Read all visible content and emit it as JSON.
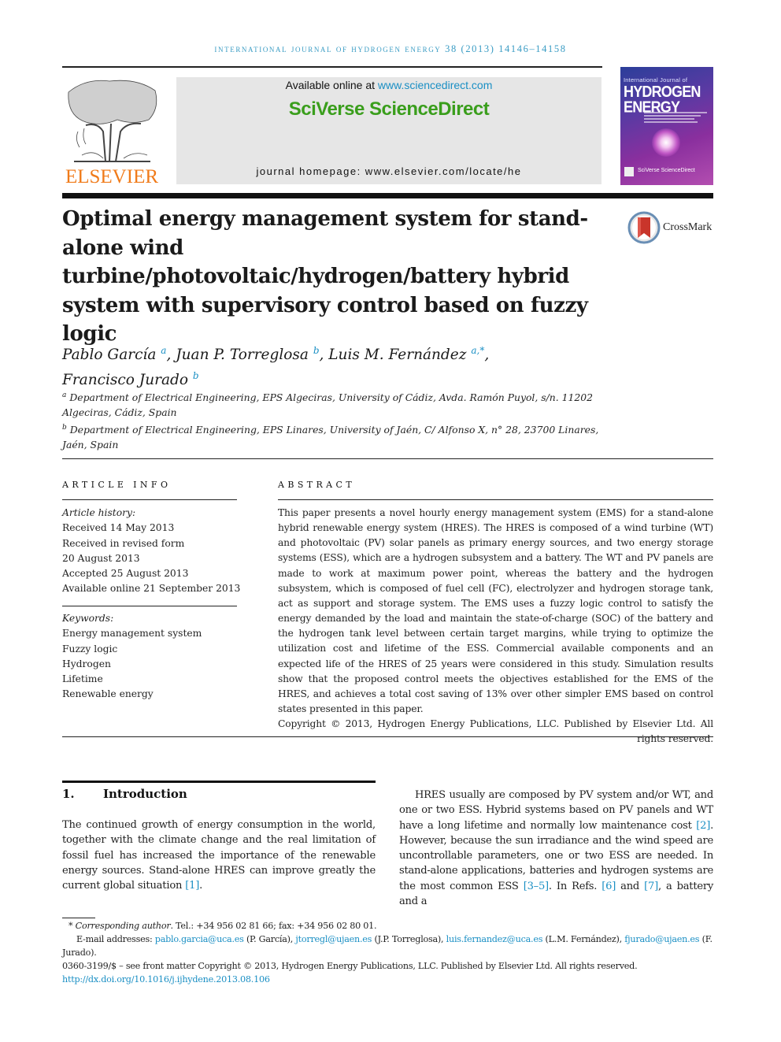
{
  "running_head": "International Journal of Hydrogen Energy 38 (2013) 14146–14158",
  "publisher": {
    "logo_text": "ELSEVIER",
    "logo_color": "#f07b1a"
  },
  "sciencedirect": {
    "available_prefix": "Available online at ",
    "available_link": "www.sciencedirect.com",
    "brand": "SciVerse ScienceDirect",
    "homepage": "journal homepage: www.elsevier.com/locate/he",
    "brand_color": "#3a9e1c",
    "link_color": "#1a8fc4"
  },
  "cover": {
    "small_title": "International Journal of",
    "title_line1": "HYDROGEN",
    "title_line2": "ENERGY",
    "footer": "SciVerse ScienceDirect"
  },
  "crossmark_label": "CrossMark",
  "title": "Optimal energy management system for stand-alone wind turbine/photovoltaic/hydrogen/battery hybrid system with supervisory control based on fuzzy logic",
  "authors": [
    {
      "name": "Pablo García",
      "aff": "a"
    },
    {
      "name": "Juan P. Torreglosa",
      "aff": "b"
    },
    {
      "name": "Luis M. Fernández",
      "aff": "a,*"
    },
    {
      "name": "Francisco Jurado",
      "aff": "b"
    }
  ],
  "affiliations": [
    {
      "key": "a",
      "text": "Department of Electrical Engineering, EPS Algeciras, University of Cádiz, Avda. Ramón Puyol, s/n. 11202 Algeciras, Cádiz, Spain"
    },
    {
      "key": "b",
      "text": "Department of Electrical Engineering, EPS Linares, University of Jaén, C/ Alfonso X, n° 28, 23700 Linares, Jaén, Spain"
    }
  ],
  "article_info": {
    "label": "ARTICLE INFO",
    "history_label": "Article history:",
    "history": [
      "Received 14 May 2013",
      "Received in revised form",
      "20 August 2013",
      "Accepted 25 August 2013",
      "Available online 21 September 2013"
    ],
    "keywords_label": "Keywords:",
    "keywords": [
      "Energy management system",
      "Fuzzy logic",
      "Hydrogen",
      "Lifetime",
      "Renewable energy"
    ]
  },
  "abstract": {
    "label": "ABSTRACT",
    "text": "This paper presents a novel hourly energy management system (EMS) for a stand-alone hybrid renewable energy system (HRES). The HRES is composed of a wind turbine (WT) and photovoltaic (PV) solar panels as primary energy sources, and two energy storage systems (ESS), which are a hydrogen subsystem and a battery. The WT and PV panels are made to work at maximum power point, whereas the battery and the hydrogen subsystem, which is composed of fuel cell (FC), electrolyzer and hydrogen storage tank, act as support and storage system. The EMS uses a fuzzy logic control to satisfy the energy demanded by the load and maintain the state-of-charge (SOC) of the battery and the hydrogen tank level between certain target margins, while trying to optimize the utilization cost and lifetime of the ESS. Commercial available components and an expected life of the HRES of 25 years were considered in this study. Simulation results show that the proposed control meets the objectives established for the EMS of the HRES, and achieves a total cost saving of 13% over other simpler EMS based on control states presented in this paper.",
    "copyright": "Copyright © 2013, Hydrogen Energy Publications, LLC. Published by Elsevier Ltd. All rights reserved."
  },
  "introduction": {
    "number": "1.",
    "heading": "Introduction",
    "left_para": "The continued growth of energy consumption in the world, together with the climate change and the real limitation of fossil fuel has increased the importance of the renewable energy sources. Stand-alone HRES can improve greatly the current global situation ",
    "left_ref": "[1]",
    "left_end": ".",
    "right_parts": [
      {
        "t": "HRES usually are composed by PV system and/or WT, and one or two ESS. Hybrid systems based on PV panels and WT have a long lifetime and normally low maintenance cost "
      },
      {
        "r": "[2]"
      },
      {
        "t": ". However, because the sun irradiance and the wind speed are uncontrollable parameters, one or two ESS are needed. In stand-alone applications, batteries and hydrogen systems are the most common ESS "
      },
      {
        "r": "[3–5]"
      },
      {
        "t": ". In Refs. "
      },
      {
        "r": "[6]"
      },
      {
        "t": " and "
      },
      {
        "r": "[7]"
      },
      {
        "t": ", a battery and a"
      }
    ]
  },
  "footnotes": {
    "corresponding_star": "*",
    "corresponding_label": "Corresponding author",
    "corresponding_rest": ". Tel.: +34 956 02 81 66; fax: +34 956 02 80 01.",
    "email_label": "E-mail addresses: ",
    "emails": [
      {
        "addr": "pablo.garcia@uca.es",
        "who": " (P. García), "
      },
      {
        "addr": "jtorregl@ujaen.es",
        "who": " (J.P. Torreglosa), "
      },
      {
        "addr": "luis.fernandez@uca.es",
        "who": " (L.M. Fernández), "
      },
      {
        "addr": "fjurado@ujaen.es",
        "who": " (F. Jurado)."
      }
    ],
    "issn_line": "0360-3199/$ – see front matter Copyright © 2013, Hydrogen Energy Publications, LLC. Published by Elsevier Ltd. All rights reserved.",
    "doi": "http://dx.doi.org/10.1016/j.ijhydene.2013.08.106"
  },
  "colors": {
    "link": "#1a8fc4",
    "running_head": "#3a9cc4"
  }
}
